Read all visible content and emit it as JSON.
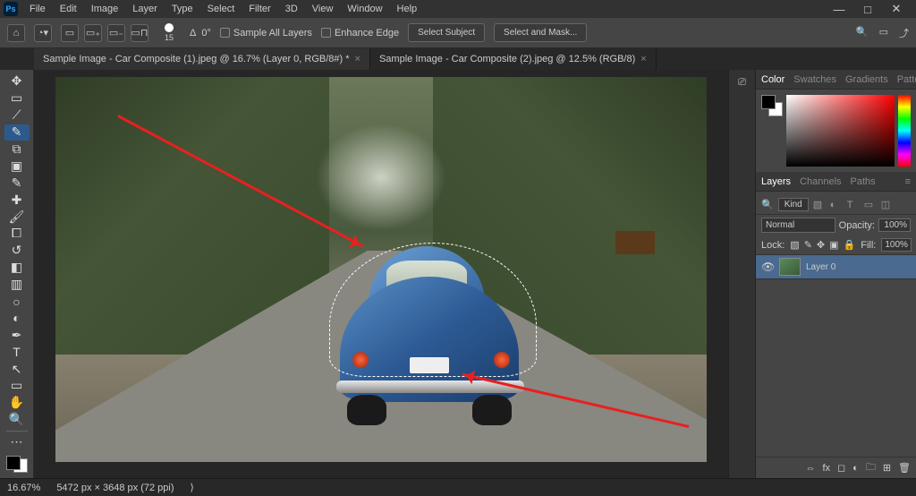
{
  "app": {
    "logo": "Ps"
  },
  "menubar": [
    "File",
    "Edit",
    "Image",
    "Layer",
    "Type",
    "Select",
    "Filter",
    "3D",
    "View",
    "Window",
    "Help"
  ],
  "window_controls": {
    "min": "—",
    "max": "□",
    "close": "✕"
  },
  "optionsbar": {
    "brush_size": "15",
    "angle_label": "Δ",
    "angle_value": "0°",
    "sample_all": "Sample All Layers",
    "enhance_edge": "Enhance Edge",
    "select_subject": "Select Subject",
    "select_and_mask": "Select and Mask..."
  },
  "doc_tabs": [
    {
      "label": "Sample Image - Car Composite (1).jpeg @ 16.7% (Layer 0, RGB/8#) *",
      "active": true
    },
    {
      "label": "Sample Image - Car Composite (2).jpeg @ 12.5% (RGB/8)",
      "active": false
    }
  ],
  "panels": {
    "color_tabs": [
      "Color",
      "Swatches",
      "Gradients",
      "Patterns"
    ],
    "layers_tabs": [
      "Layers",
      "Channels",
      "Paths"
    ],
    "kind_label": "Kind",
    "blend_mode": "Normal",
    "opacity_label": "Opacity:",
    "opacity_value": "100%",
    "lock_label": "Lock:",
    "fill_label": "Fill:",
    "fill_value": "100%",
    "layer": {
      "name": "Layer 0"
    }
  },
  "status": {
    "zoom": "16.67%",
    "dims": "5472 px × 3648 px (72 ppi)",
    "chev": "⟩"
  }
}
